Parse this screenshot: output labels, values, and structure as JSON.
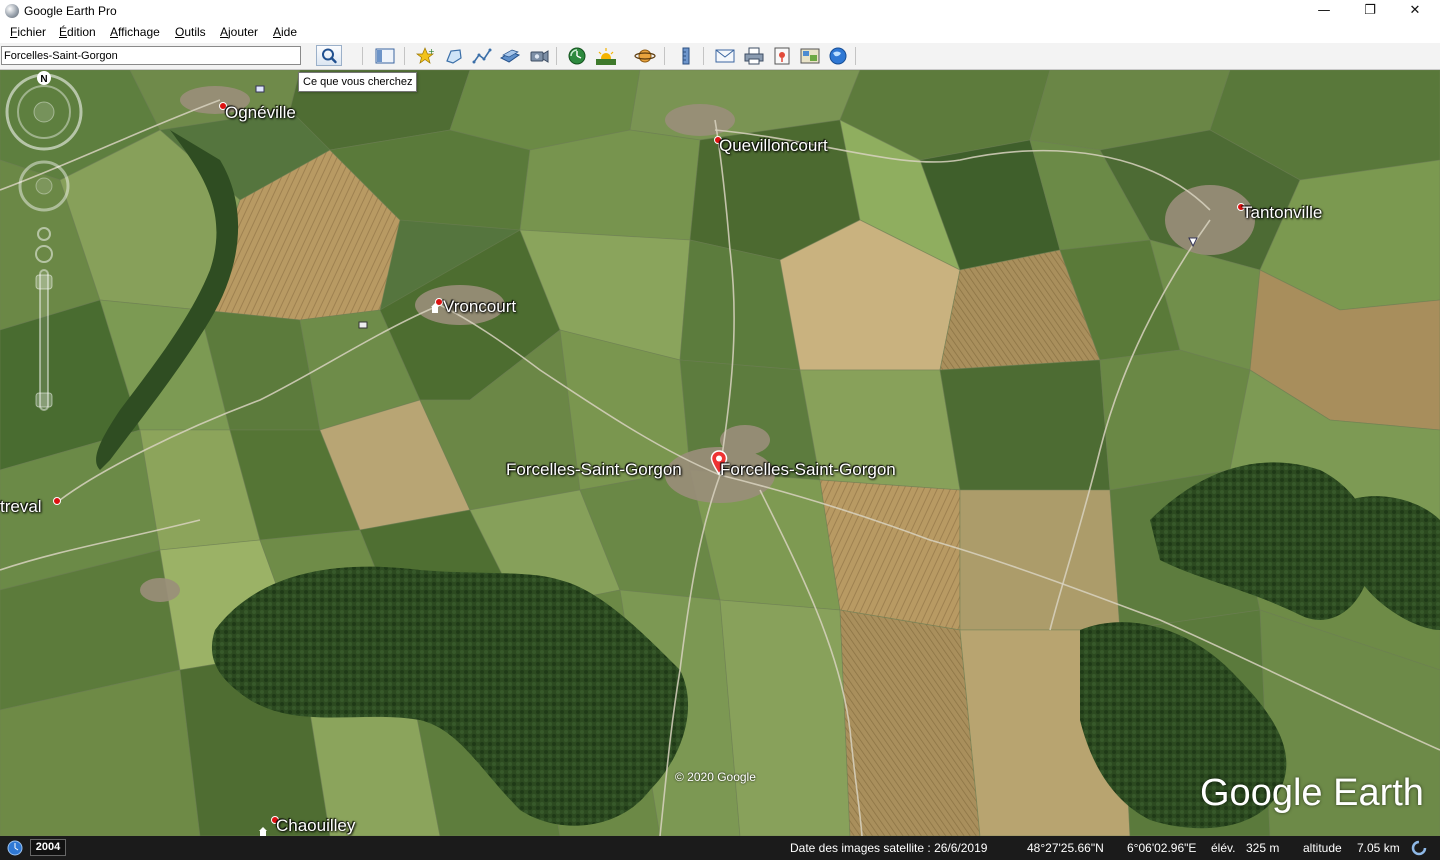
{
  "window": {
    "title": "Google Earth Pro",
    "minimize_glyph": "—",
    "maximize_glyph": "❐",
    "close_glyph": "✕"
  },
  "menu": [
    {
      "label": "Fichier"
    },
    {
      "label": "Édition"
    },
    {
      "label": "Affichage"
    },
    {
      "label": "Outils"
    },
    {
      "label": "Ajouter"
    },
    {
      "label": "Aide"
    }
  ],
  "search": {
    "value": "Forcelles-Saint-Gorgon",
    "tooltip": "Ce que vous cherchez"
  },
  "toolbar_icons": [
    "sidebar-toggle-icon",
    "add-placemark-icon",
    "add-polygon-icon",
    "add-path-icon",
    "add-image-overlay-icon",
    "record-tour-icon",
    "historical-imagery-icon",
    "sunlight-icon",
    "planets-icon",
    "ruler-icon",
    "email-icon",
    "print-icon",
    "save-image-icon",
    "view-in-maps-icon",
    "earth-gallery-icon"
  ],
  "map": {
    "places": [
      {
        "name": "Ognéville"
      },
      {
        "name": "Quevilloncourt"
      },
      {
        "name": "Tantonville"
      },
      {
        "name": "Vroncourt"
      },
      {
        "name": "Forcelles-Saint-Gorgon"
      },
      {
        "name": "Forcelles-Saint-Gorgon"
      },
      {
        "name": "treval"
      },
      {
        "name": "Chaouilley"
      }
    ],
    "copyright": "© 2020 Google",
    "brand": "Google Earth",
    "compass_north": "N"
  },
  "status": {
    "history_year": "2004",
    "imagery_date": "Date des images satellite : 26/6/2019",
    "lat": "48°27'25.66\"N",
    "lon": "6°06'02.96\"E",
    "elev_label": "élév.",
    "elev_value": "325 m",
    "altitude_label": "altitude",
    "altitude_value": "7.05 km"
  }
}
